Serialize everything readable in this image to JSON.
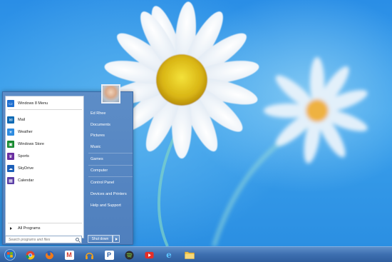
{
  "start_menu": {
    "programs": [
      {
        "label": "Windows 8 Menu",
        "icon": "windows8-menu-icon",
        "color": "#1f6fd0"
      },
      {
        "label": "Mail",
        "icon": "mail-icon",
        "color": "#0f6ab4"
      },
      {
        "label": "Weather",
        "icon": "weather-icon",
        "color": "#2d8be0"
      },
      {
        "label": "Windows Store",
        "icon": "store-icon",
        "color": "#178a2f"
      },
      {
        "label": "Sports",
        "icon": "sports-icon",
        "color": "#6a2fa0"
      },
      {
        "label": "SkyDrive",
        "icon": "skydrive-icon",
        "color": "#1c5fb8"
      },
      {
        "label": "Calendar",
        "icon": "calendar-icon",
        "color": "#5b3fa6"
      }
    ],
    "all_programs_label": "All Programs",
    "search_placeholder": "Search programs and files",
    "right_items": {
      "user": "Ed Rhee",
      "documents": "Documents",
      "pictures": "Pictures",
      "music": "Music",
      "games": "Games",
      "computer": "Computer",
      "control_panel": "Control Panel",
      "devices_printers": "Devices and Printers",
      "help_support": "Help and Support"
    },
    "shutdown_label": "Shut down"
  },
  "taskbar": {
    "icons": [
      "windows-start-icon",
      "chrome-icon",
      "firefox-icon",
      "gmail-icon",
      "headphones-icon",
      "pandora-icon",
      "spotify-icon",
      "youtube-icon",
      "internet-explorer-icon",
      "file-explorer-icon"
    ]
  },
  "colors": {
    "menu_blue": "#4f7fbd",
    "taskbar": "#3d6fb0",
    "desktop": "#2a8ee6"
  }
}
